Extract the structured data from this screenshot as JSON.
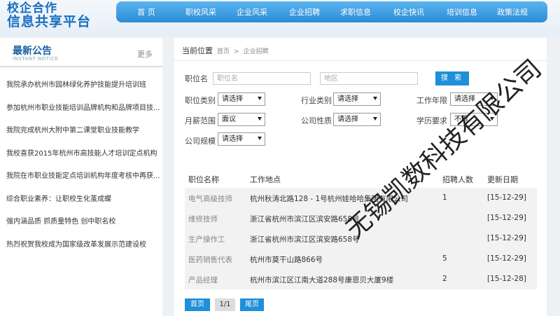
{
  "logo": {
    "line1": "校企合作",
    "line2": "信息共享平台"
  },
  "nav": [
    "首 页",
    "职校风采",
    "企业风采",
    "企业招聘",
    "求职信息",
    "校企快讯",
    "培训信息",
    "政策法规"
  ],
  "sidebar": {
    "title": "最新公告",
    "subtitle": "INSTANT NOTICE",
    "more": "更多",
    "items": [
      "我院承办杭州市园林绿化养护技能提升培训班",
      "参加杭州市职业技能培训品牌机构和品牌项目技...",
      "我院完成杭州大附中第二课堂职业技能教学",
      "我校喜获2015年杭州市高技能人才培训定点机构",
      "我院在市职业技能定点培训机构年度考核中再获...",
      "综合职业素养：让职校生化茧成蝶",
      "强内涵品质 抓质量特色 创中职名校",
      "热烈祝贺我校成为国家级改革发展示范建设校"
    ]
  },
  "breadcrumb": {
    "label": "当前位置",
    "home": "首页",
    "sep": ">",
    "current": "企业招聘"
  },
  "search": {
    "job_label": "职位名",
    "job_placeholder": "职位名",
    "area_placeholder": "地区",
    "button": "搜 索"
  },
  "filters": {
    "job_category": {
      "label": "职位类别",
      "value": "请选择"
    },
    "industry": {
      "label": "行业类别",
      "value": "请选择"
    },
    "work_years": {
      "label": "工作年限",
      "value": "请选择"
    },
    "salary": {
      "label": "月薪范围",
      "value": "面议"
    },
    "company_type": {
      "label": "公司性质",
      "value": "请选择"
    },
    "education": {
      "label": "学历要求",
      "value": "不限"
    },
    "company_size": {
      "label": "公司规模",
      "value": "请选择"
    }
  },
  "table": {
    "headers": [
      "职位名称",
      "工作地点",
      "招聘人数",
      "更新日期"
    ],
    "rows": [
      {
        "job": "电气高级技师",
        "location": "杭州秋涛北路128 - 1号杭州娃哈哈集团有限公司",
        "count": "1",
        "date": "[15-12-29]"
      },
      {
        "job": "维修技师",
        "location": "浙江省杭州市滨江区滨安路658号",
        "count": "",
        "date": "[15-12-29]"
      },
      {
        "job": "生产操作工",
        "location": "浙江省杭州市滨江区滨安路658号",
        "count": "",
        "date": "[15-12-29]"
      },
      {
        "job": "医药销售代表",
        "location": "杭州市莫干山路866号",
        "count": "5",
        "date": "[15-12-29]"
      },
      {
        "job": "产品经理",
        "location": "杭州市滨江区江南大道288号康恩贝大厦9楼",
        "count": "2",
        "date": "[15-12-28]"
      }
    ]
  },
  "pager": {
    "first": "首页",
    "page": "1/1",
    "last": "尾页"
  },
  "watermark": "无锡凯数科技有限公司"
}
